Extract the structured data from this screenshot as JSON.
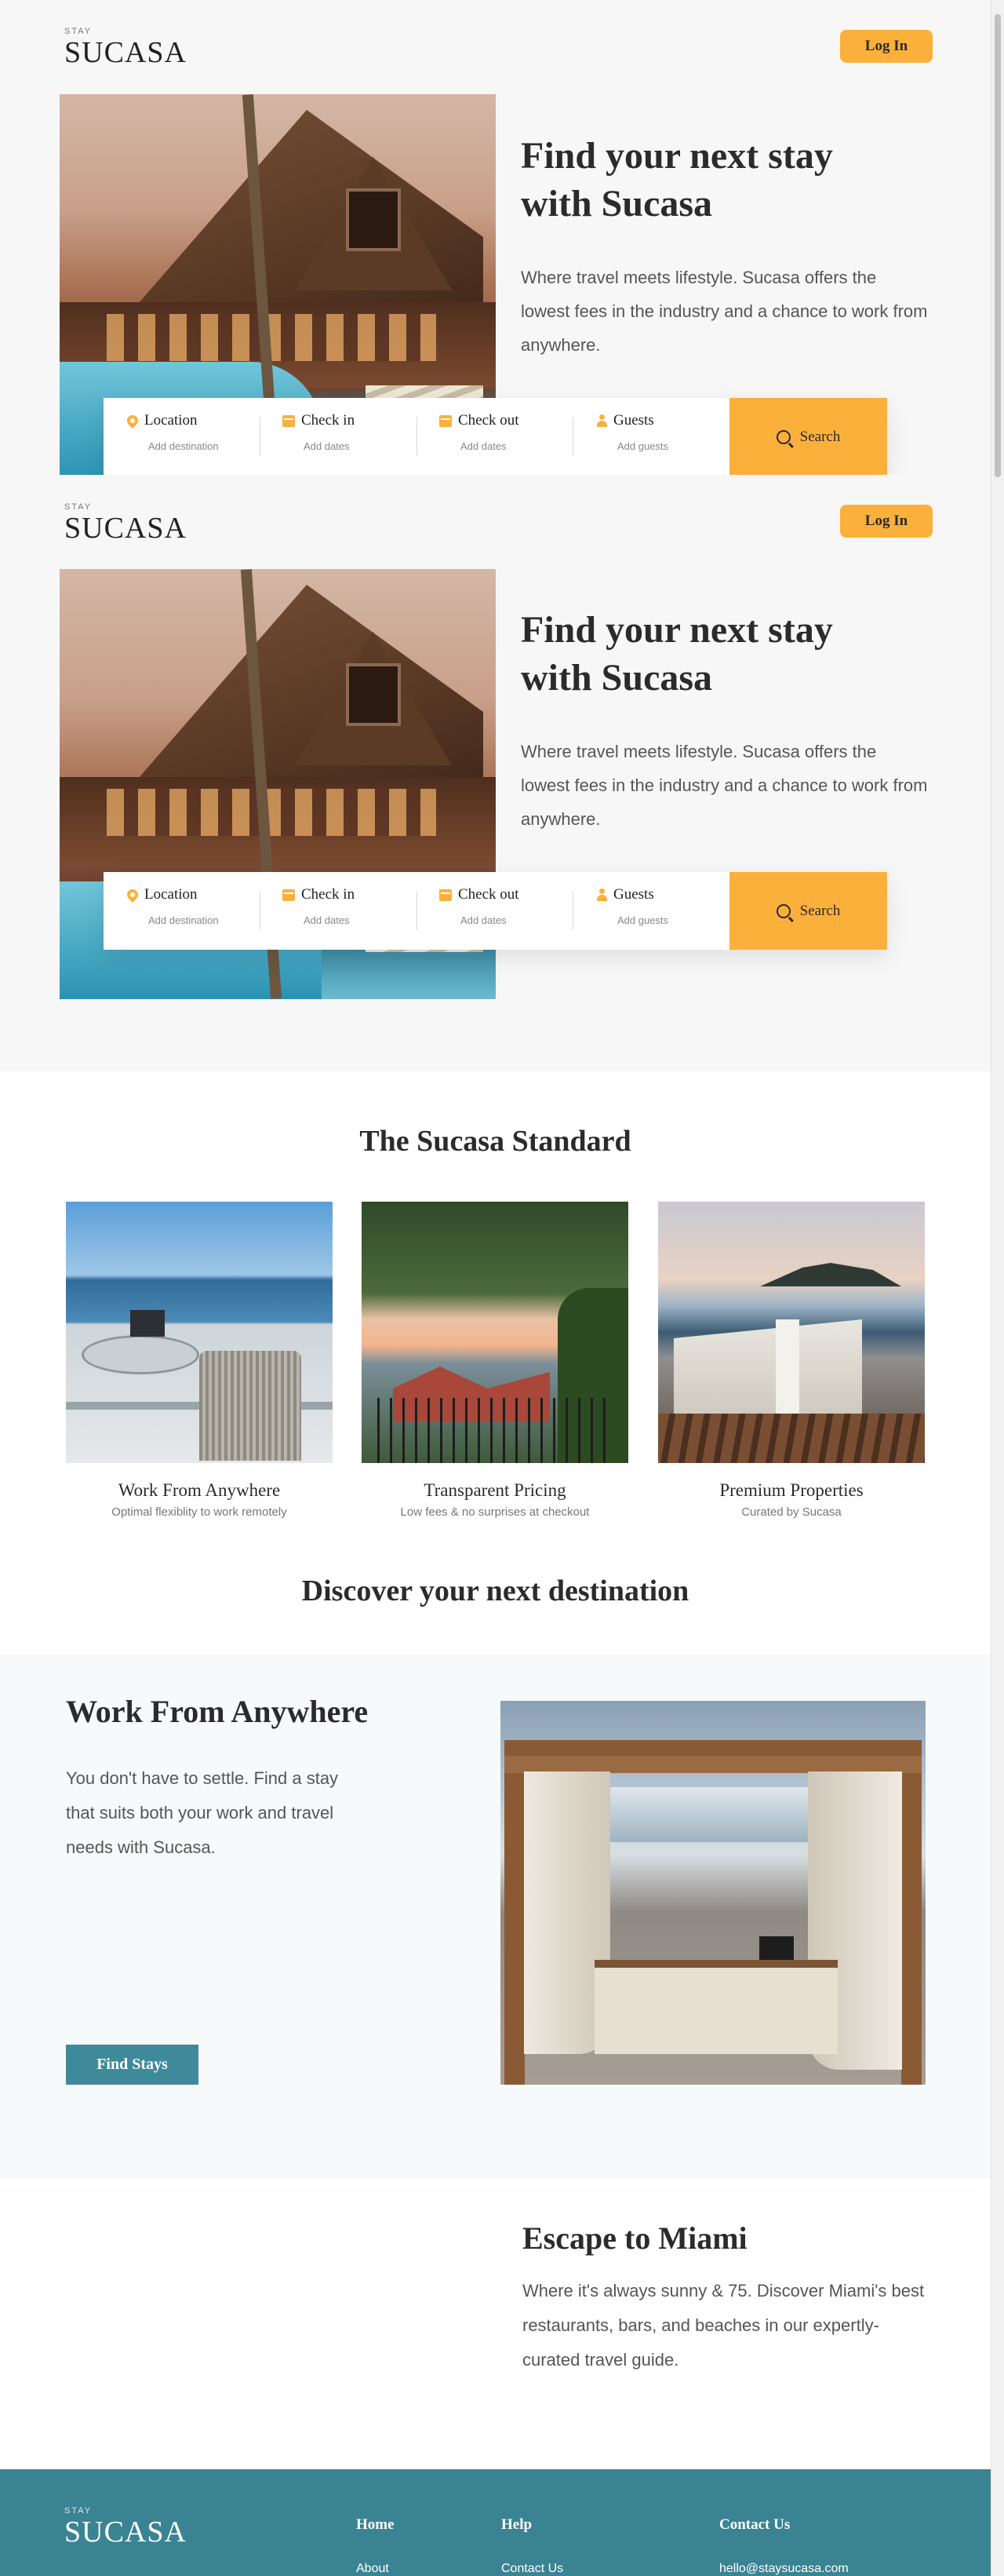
{
  "header": {
    "logo_tag": "STAY",
    "logo_name": "SUCASA",
    "login_label": "Log In"
  },
  "hero": {
    "title_line1": "Find your next stay",
    "title_line2": "with Sucasa",
    "subtitle": "Where travel meets lifestyle. Sucasa offers the lowest fees in the industry and a chance to work from anywhere."
  },
  "search": {
    "fields": [
      {
        "label": "Location",
        "sub": "Add destination",
        "icon": "map-pin-icon"
      },
      {
        "label": "Check in",
        "sub": "Add dates",
        "icon": "calendar-icon"
      },
      {
        "label": "Check out",
        "sub": "Add dates",
        "icon": "calendar-icon"
      },
      {
        "label": "Guests",
        "sub": "Add guests",
        "icon": "user-icon"
      }
    ],
    "button_label": "Search"
  },
  "standard": {
    "title": "The Sucasa Standard",
    "features": [
      {
        "name": "Work From Anywhere",
        "desc": "Optimal flexiblity to work remotely"
      },
      {
        "name": "Transparent Pricing",
        "desc": "Low fees & no surprises at checkout"
      },
      {
        "name": "Premium Properties",
        "desc": "Curated by Sucasa"
      }
    ]
  },
  "discover": {
    "title": "Discover your next destination"
  },
  "wfa": {
    "title": "Work From Anywhere",
    "text": "You don't have to settle. Find a stay that suits both your work and travel needs with Sucasa.",
    "button_label": "Find Stays"
  },
  "miami": {
    "title": "Escape to Miami",
    "text": "Where it's always sunny & 75. Discover Miami's best restaurants, bars, and beaches in our expertly-curated travel guide."
  },
  "footer": {
    "logo_tag": "STAY",
    "logo_name": "SUCASA",
    "tagline": "",
    "columns": [
      {
        "heading": "Home",
        "link": "About"
      },
      {
        "heading": "Help",
        "link": "Contact Us"
      },
      {
        "heading": "Contact Us",
        "link": "hello@staysucasa.com"
      }
    ]
  },
  "colors": {
    "accent": "#fbb03b",
    "teal": "#3f8a9a",
    "footer_bg": "#3a8393",
    "page_bg": "#f7f7f7"
  }
}
